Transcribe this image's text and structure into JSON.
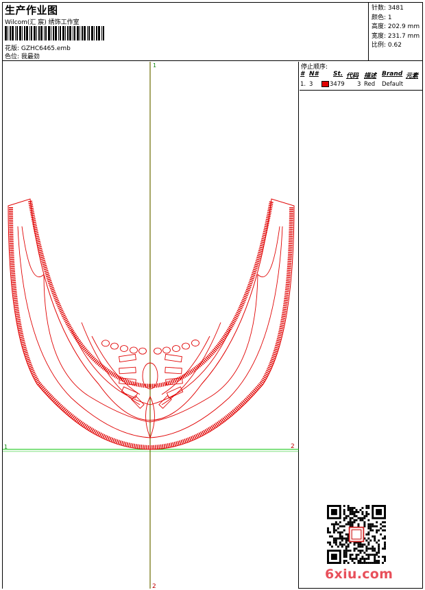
{
  "header": {
    "title": "生产作业图",
    "company": "Wilcom(汇 宸) 绣饰工作室",
    "pattern_label": "花版:",
    "pattern_value": "GZHC6465.emb",
    "color_label": "色位:",
    "color_value": "我最劲"
  },
  "stats": [
    {
      "label": "针数:",
      "value": "3481"
    },
    {
      "label": "颜色:",
      "value": "1"
    },
    {
      "label": "高度:",
      "value": "202.9 mm"
    },
    {
      "label": "宽度:",
      "value": "231.7 mm"
    },
    {
      "label": "比例:",
      "value": "0.62"
    }
  ],
  "stop_sequence": {
    "title": "停止顺序:",
    "headers": [
      "#",
      "N#",
      "St.",
      "代码",
      "描述",
      "Brand",
      "元素"
    ],
    "rows": [
      {
        "num": "1.",
        "n": "3",
        "stitches": "3479",
        "code": "3",
        "description": "Red",
        "brand": "Default",
        "element": ""
      }
    ]
  },
  "axis_labels": {
    "top": "1",
    "left": "1",
    "right": "2",
    "bottom": "2"
  },
  "watermark": "6xiu.com",
  "colors": {
    "thread": "#e00000",
    "axis_v": "#6b6b00",
    "axis_h": "#00c000",
    "watermark": "#e8505b"
  }
}
